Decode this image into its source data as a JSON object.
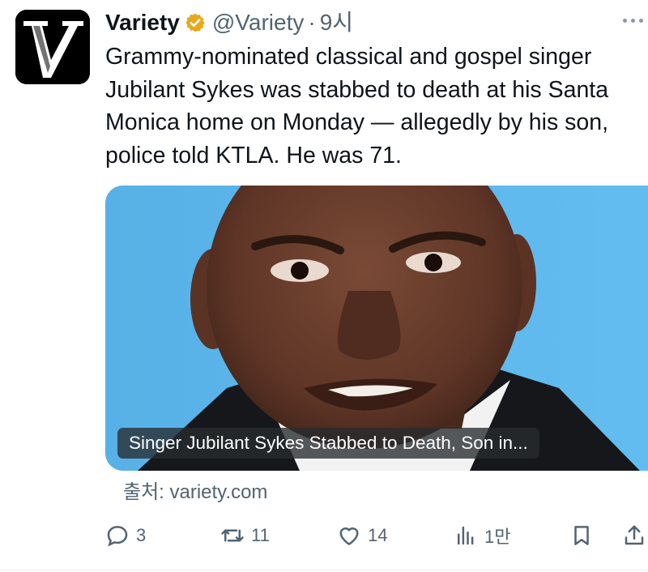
{
  "tweet": {
    "display_name": "Variety",
    "handle": "@Variety",
    "separator": "·",
    "timestamp": "9시",
    "text": "Grammy-nominated classical and gospel singer Jubilant Sykes was stabbed to death at his Santa Monica home on Monday — allegedly by his son, police told KTLA. He was 71.",
    "avatar_icon": "variety-v-logo",
    "verified_icon": "verified-gold-badge",
    "verified_color": "#e8a81c",
    "more_icon": "more-dots-icon"
  },
  "card": {
    "caption": "Singer Jubilant Sykes Stabbed to Death, Son in...",
    "source": "출처: variety.com",
    "image_background": "#5cb6e8"
  },
  "actions": {
    "reply": {
      "icon": "reply-icon",
      "count": "3"
    },
    "repost": {
      "icon": "repost-icon",
      "count": "11"
    },
    "like": {
      "icon": "heart-icon",
      "count": "14"
    },
    "views": {
      "icon": "views-icon",
      "count": "1만"
    },
    "bookmark": {
      "icon": "bookmark-icon"
    },
    "share": {
      "icon": "share-icon"
    }
  },
  "colors": {
    "text": "#0f1419",
    "secondary_text": "#536471"
  }
}
